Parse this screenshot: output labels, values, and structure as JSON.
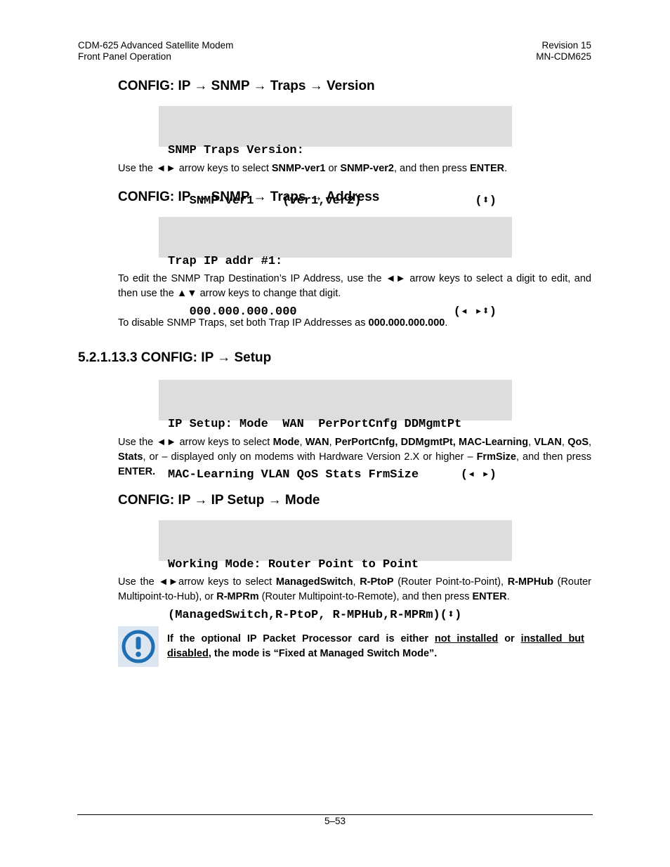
{
  "header": {
    "left_line1": "CDM-625 Advanced Satellite Modem",
    "left_line2": "Front Panel Operation",
    "right_line1": "Revision 15",
    "right_line2": "MN-CDM625"
  },
  "sections": {
    "traps_version": {
      "heading": "CONFIG: IP → SNMP → Traps → Version",
      "lcd_line1": "SNMP Traps Version:",
      "lcd_line2": "   SNMP-ver1    (ver1,ver2)",
      "lcd_keys": "(⬍)",
      "desc_pre": "Use the ◄► arrow keys to select  ",
      "desc_b1": "SNMP-ver1",
      "desc_mid": " or ",
      "desc_b2": "SNMP-ver2",
      "desc_post": ", and then press ",
      "desc_b3": "ENTER",
      "desc_end": "."
    },
    "traps_address": {
      "heading": "CONFIG: IP → SNMP → Traps → Address",
      "lcd_line1": "Trap IP addr #1:",
      "lcd_line2": "   000.000.000.000",
      "lcd_keys": "(◂ ▸⬍)",
      "desc1": "To edit the SNMP Trap Destination’s IP Address, use the ◄► arrow keys to select a digit to edit, and then use the ▲▼ arrow keys to change that digit.",
      "desc2_pre": "To disable SNMP Traps, set both Trap IP Addresses as ",
      "desc2_b": "000.000.000.000",
      "desc2_end": "."
    },
    "ip_setup": {
      "heading": "5.2.1.13.3 CONFIG: IP → Setup",
      "lcd_line1": "IP Setup: Mode  WAN  PerPortCnfg DDMgmtPt",
      "lcd_line2": "MAC-Learning VLAN QoS Stats FrmSize",
      "lcd_keys": "(◂ ▸)",
      "desc_parts": [
        {
          "t": "Use the ◄► arrow keys to select ",
          "b": false
        },
        {
          "t": "Mode",
          "b": true
        },
        {
          "t": ", ",
          "b": false
        },
        {
          "t": "WAN",
          "b": true
        },
        {
          "t": ", ",
          "b": false
        },
        {
          "t": "PerPortCnfg, DDMgmtPt, MAC-Learning",
          "b": true
        },
        {
          "t": ",  ",
          "b": false
        },
        {
          "t": "VLAN",
          "b": true
        },
        {
          "t": ", ",
          "b": false
        },
        {
          "t": "QoS",
          "b": true
        },
        {
          "t": ", ",
          "b": false
        },
        {
          "t": "Stats",
          "b": true
        },
        {
          "t": ", or – displayed only on modems with Hardware Version 2.X or higher – ",
          "b": false
        },
        {
          "t": "FrmSize",
          "b": true
        },
        {
          "t": ", and then press ",
          "b": false
        },
        {
          "t": "ENTER.",
          "b": true
        }
      ]
    },
    "ip_setup_mode": {
      "heading": "CONFIG: IP → IP Setup → Mode",
      "lcd_line1": "Working Mode: Router Point to Point",
      "lcd_line2": "(ManagedSwitch,R-PtoP, R-MPHub,R-MPRm)(⬍)",
      "desc_parts": [
        {
          "t": "Use the ◄►arrow keys to select ",
          "b": false
        },
        {
          "t": "ManagedSwitch",
          "b": true
        },
        {
          "t": ", ",
          "b": false
        },
        {
          "t": "R-PtoP",
          "b": true
        },
        {
          "t": " (Router Point-to-Point), ",
          "b": false
        },
        {
          "t": "R-MPHub",
          "b": true
        },
        {
          "t": " (Router Multipoint-to-Hub), or ",
          "b": false
        },
        {
          "t": "R-MPRm",
          "b": true
        },
        {
          "t": " (Router Multipoint-to-Remote), and then press ",
          "b": false
        },
        {
          "t": "ENTER",
          "b": true
        },
        {
          "t": ".",
          "b": false
        }
      ]
    }
  },
  "note": {
    "icon": "exclamation-circle-icon",
    "icon_color": "#1f6fb5",
    "pre": "If the optional IP Packet Processor card is either ",
    "u1": "not installed",
    "mid": " or ",
    "u2": "installed but disabled",
    "post": ", the mode is “Fixed at Managed Switch Mode”."
  },
  "footer": {
    "page_number": "5–53"
  }
}
